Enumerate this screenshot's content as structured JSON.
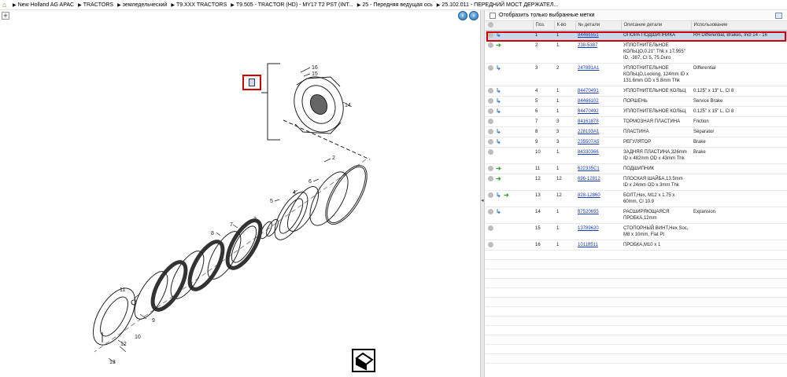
{
  "breadcrumb": [
    "New Holland AG APAC",
    "TRACTORS",
    "земледельческий",
    "T9.XXX TRACTORS",
    "T9.505 - TRACTOR (HD) - MY17 T2 PST (INT...",
    "25 - Передняя ведущая ось",
    "25.102.011 - ПЕРЕДНИЙ МОСТ ДЕРЖАТЕЛ..."
  ],
  "drawing": {
    "callout_numbers": [
      "16",
      "15",
      "14",
      "2",
      "6",
      "4",
      "5",
      "3",
      "7",
      "8",
      "11",
      "9",
      "12",
      "10",
      "13"
    ]
  },
  "filter": {
    "label": "Отобразить только выбранные метки",
    "checked": false
  },
  "table": {
    "headers": {
      "pos": "Поз.",
      "qty": "К-во",
      "part_no": "№ детали",
      "description": "Описание детали",
      "usage": "Использование"
    },
    "rows": [
      {
        "pos": "1",
        "qty": "1",
        "part_no": "84466551",
        "description": "ОПОРА ПОДШИПНИКА",
        "usage": "RH Differential, Brakes, Incl 14 - 16",
        "icons": [
          "gray",
          "blue"
        ],
        "selected": true
      },
      {
        "pos": "2",
        "qty": "1",
        "part_no": "238-5387",
        "description": "УПЛОТНИТЕЛЬНОЕ КОЛЬЦО,0.21\" Thk x 17.955\" ID, -387, CI 5, 75 Duro",
        "usage": "",
        "icons": [
          "gray",
          "green"
        ]
      },
      {
        "pos": "3",
        "qty": "2",
        "part_no": "247881A1",
        "description": "УПЛОТНИТЕЛЬНОЕ КОЛЬЦО,Locking, 124mm ID x 131.6mm OD x 5.8mm Thk",
        "usage": "Differential",
        "icons": [
          "gray",
          "blue"
        ]
      },
      {
        "pos": "4",
        "qty": "1",
        "part_no": "84470491",
        "description": "УПЛОТНИТЕЛЬНОЕ КОЛЬЦ",
        "usage": "0.125\" x 13\" L, Cl 8",
        "icons": [
          "gray",
          "blue"
        ]
      },
      {
        "pos": "5",
        "qty": "1",
        "part_no": "84466102",
        "description": "ПОРШЕНЬ",
        "usage": "Service Brake",
        "icons": [
          "gray",
          "blue"
        ]
      },
      {
        "pos": "6",
        "qty": "1",
        "part_no": "84470492",
        "description": "УПЛОТНИТЕЛЬНОЕ КОЛЬЦ",
        "usage": "0.125\" x 15\" L, Cl 8",
        "icons": [
          "gray",
          "blue"
        ]
      },
      {
        "pos": "7",
        "qty": "3",
        "part_no": "84161878",
        "description": "ТОРМОЗНАЯ ПЛАСТИНА",
        "usage": "Friction",
        "icons": [
          "gray"
        ]
      },
      {
        "pos": "8",
        "qty": "3",
        "part_no": "228193A1",
        "description": "ПЛАСТИНА",
        "usage": "Separator",
        "icons": [
          "gray",
          "blue"
        ]
      },
      {
        "pos": "9",
        "qty": "3",
        "part_no": "235507A5",
        "description": "РЕГУЛЯТОР",
        "usage": "Brake",
        "icons": [
          "gray",
          "blue"
        ]
      },
      {
        "pos": "10",
        "qty": "1",
        "part_no": "84330366",
        "description": "ЗАДНЯЯ ПЛАСТИНА,326mm ID x 482mm OD x 43mm Thk",
        "usage": "Brake",
        "icons": [
          "gray"
        ]
      },
      {
        "pos": "11",
        "qty": "1",
        "part_no": "622335C1",
        "description": "ПОДШИПНИК",
        "usage": "",
        "icons": [
          "gray",
          "green"
        ]
      },
      {
        "pos": "12",
        "qty": "12",
        "part_no": "696-12812",
        "description": "ПЛОСКАЯ ШАЙБА,13.5mm ID x 24mm OD x 3mm Thk",
        "usage": "",
        "icons": [
          "gray",
          "green"
        ]
      },
      {
        "pos": "13",
        "qty": "12",
        "part_no": "828-12860",
        "description": "БОЛТ,Hex, M12 x 1.75 x 60mm, Cl 10.9",
        "usage": "",
        "icons": [
          "gray",
          "blue",
          "green"
        ]
      },
      {
        "pos": "14",
        "qty": "1",
        "part_no": "87520655",
        "description": "РАСШИРЯЮЩАЯСЯ ПРОБКА,12mm",
        "usage": "Expansion",
        "icons": [
          "gray",
          "blue"
        ]
      },
      {
        "pos": "15",
        "qty": "1",
        "part_no": "13789620",
        "description": "СТОПОРНЫЙ ВИНТ,Hex Soc, M8 x 10mm, Flat Pt",
        "usage": "",
        "icons": [
          "gray"
        ]
      },
      {
        "pos": "16",
        "qty": "1",
        "part_no": "10118511",
        "description": "ПРОБКА,M10 x 1",
        "usage": "",
        "icons": [
          "gray"
        ]
      }
    ]
  },
  "colors": {
    "selection": "#c9d7ea",
    "highlight_border": "#d00000",
    "link": "#1a3db8"
  }
}
